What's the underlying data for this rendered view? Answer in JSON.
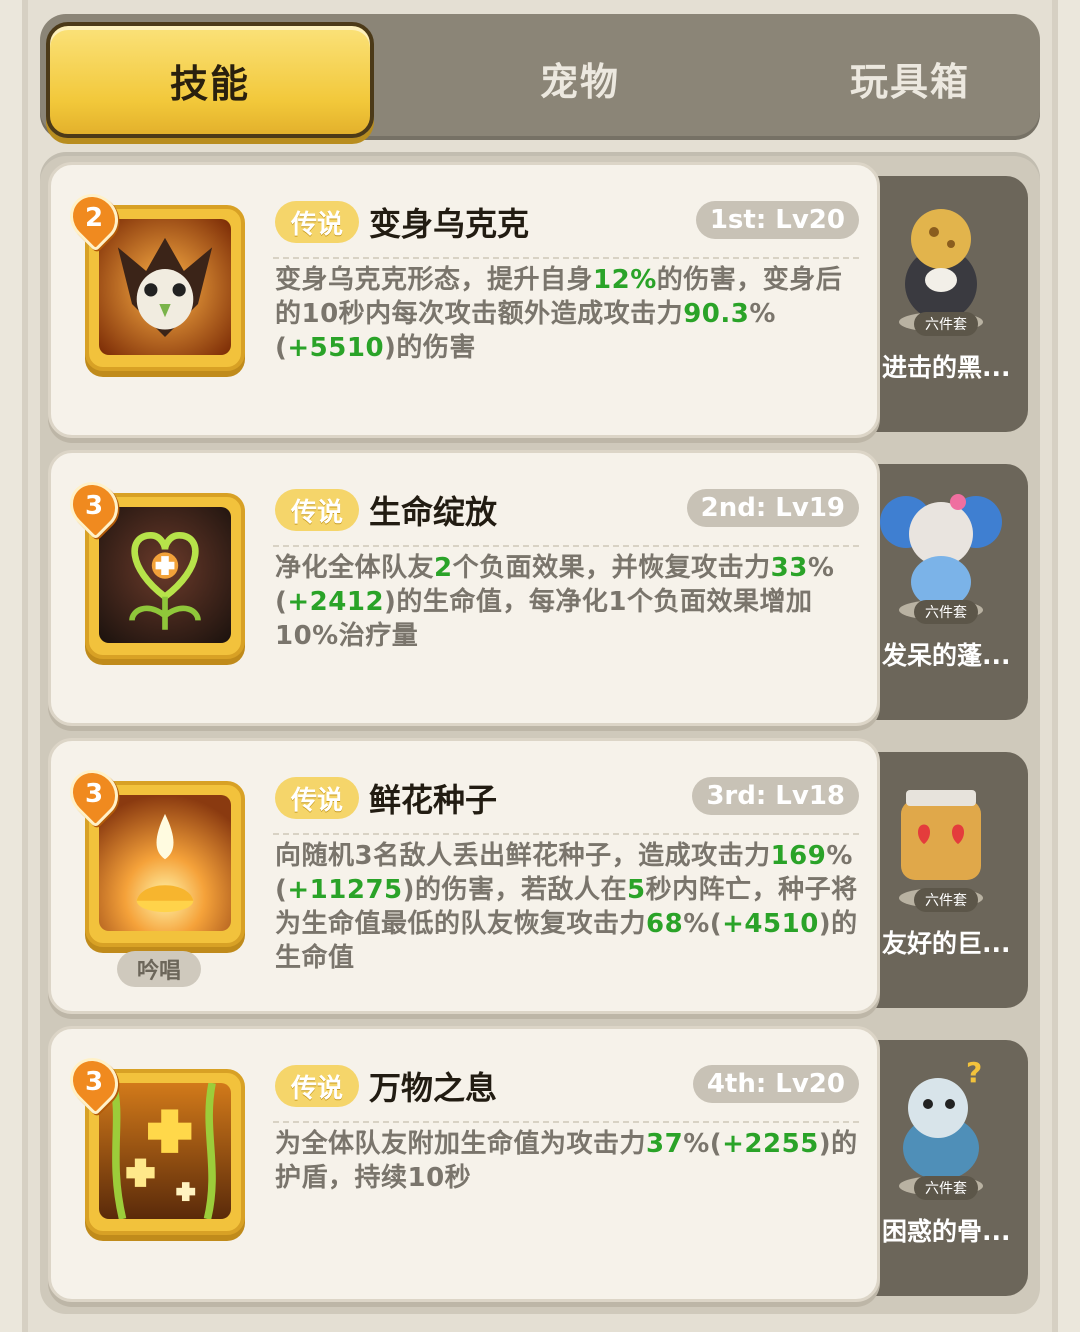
{
  "tabs": [
    {
      "label": "技能",
      "active": true
    },
    {
      "label": "宠物",
      "active": false
    },
    {
      "label": "玩具箱",
      "active": false
    }
  ],
  "skills": [
    {
      "level": "2",
      "rarity": "传说",
      "name": "变身乌克克",
      "rank": "1st: Lv20",
      "desc": [
        {
          "t": "变身乌克克形态，提升自身"
        },
        {
          "t": "12%",
          "hl": true
        },
        {
          "t": "的伤害，变身后的10秒内每次攻击额外造成攻击力"
        },
        {
          "t": "90.3",
          "hl": true
        },
        {
          "t": "%("
        },
        {
          "t": "+5510",
          "hl": true
        },
        {
          "t": ")的伤害"
        }
      ],
      "chant": "",
      "pet": {
        "set_label": "六件套",
        "name": "进击的黑..."
      },
      "icon": "owl-icon"
    },
    {
      "level": "3",
      "rarity": "传说",
      "name": "生命绽放",
      "rank": "2nd: Lv19",
      "desc": [
        {
          "t": "净化全体队友"
        },
        {
          "t": "2",
          "hl": true
        },
        {
          "t": "个负面效果，并恢复攻击力"
        },
        {
          "t": "33",
          "hl": true
        },
        {
          "t": "%("
        },
        {
          "t": "+2412",
          "hl": true
        },
        {
          "t": ")的生命值，每净化1个负面效果增加10%治疗量"
        }
      ],
      "chant": "",
      "pet": {
        "set_label": "六件套",
        "name": "发呆的蓬..."
      },
      "icon": "heart-flower-icon"
    },
    {
      "level": "3",
      "rarity": "传说",
      "name": "鲜花种子",
      "rank": "3rd: Lv18",
      "desc": [
        {
          "t": "向随机3名敌人丢出鲜花种子，造成攻击力"
        },
        {
          "t": "169",
          "hl": true
        },
        {
          "t": "%("
        },
        {
          "t": "+11275",
          "hl": true
        },
        {
          "t": ")的伤害，若敌人在"
        },
        {
          "t": "5",
          "hl": true
        },
        {
          "t": "秒内阵亡，种子将为生命值最低的队友恢复攻击力"
        },
        {
          "t": "68",
          "hl": true
        },
        {
          "t": "%("
        },
        {
          "t": "+4510",
          "hl": true
        },
        {
          "t": ")的生命值"
        }
      ],
      "chant": "吟唱",
      "pet": {
        "set_label": "六件套",
        "name": "友好的巨..."
      },
      "icon": "flower-seed-icon"
    },
    {
      "level": "3",
      "rarity": "传说",
      "name": "万物之息",
      "rank": "4th: Lv20",
      "desc": [
        {
          "t": "为全体队友附加生命值为攻击力"
        },
        {
          "t": "37",
          "hl": true
        },
        {
          "t": "%("
        },
        {
          "t": "+2255",
          "hl": true
        },
        {
          "t": ")的护盾，持续10秒"
        }
      ],
      "chant": "",
      "pet": {
        "set_label": "六件套",
        "name": "困惑的骨..."
      },
      "icon": "healing-cross-icon"
    }
  ]
}
